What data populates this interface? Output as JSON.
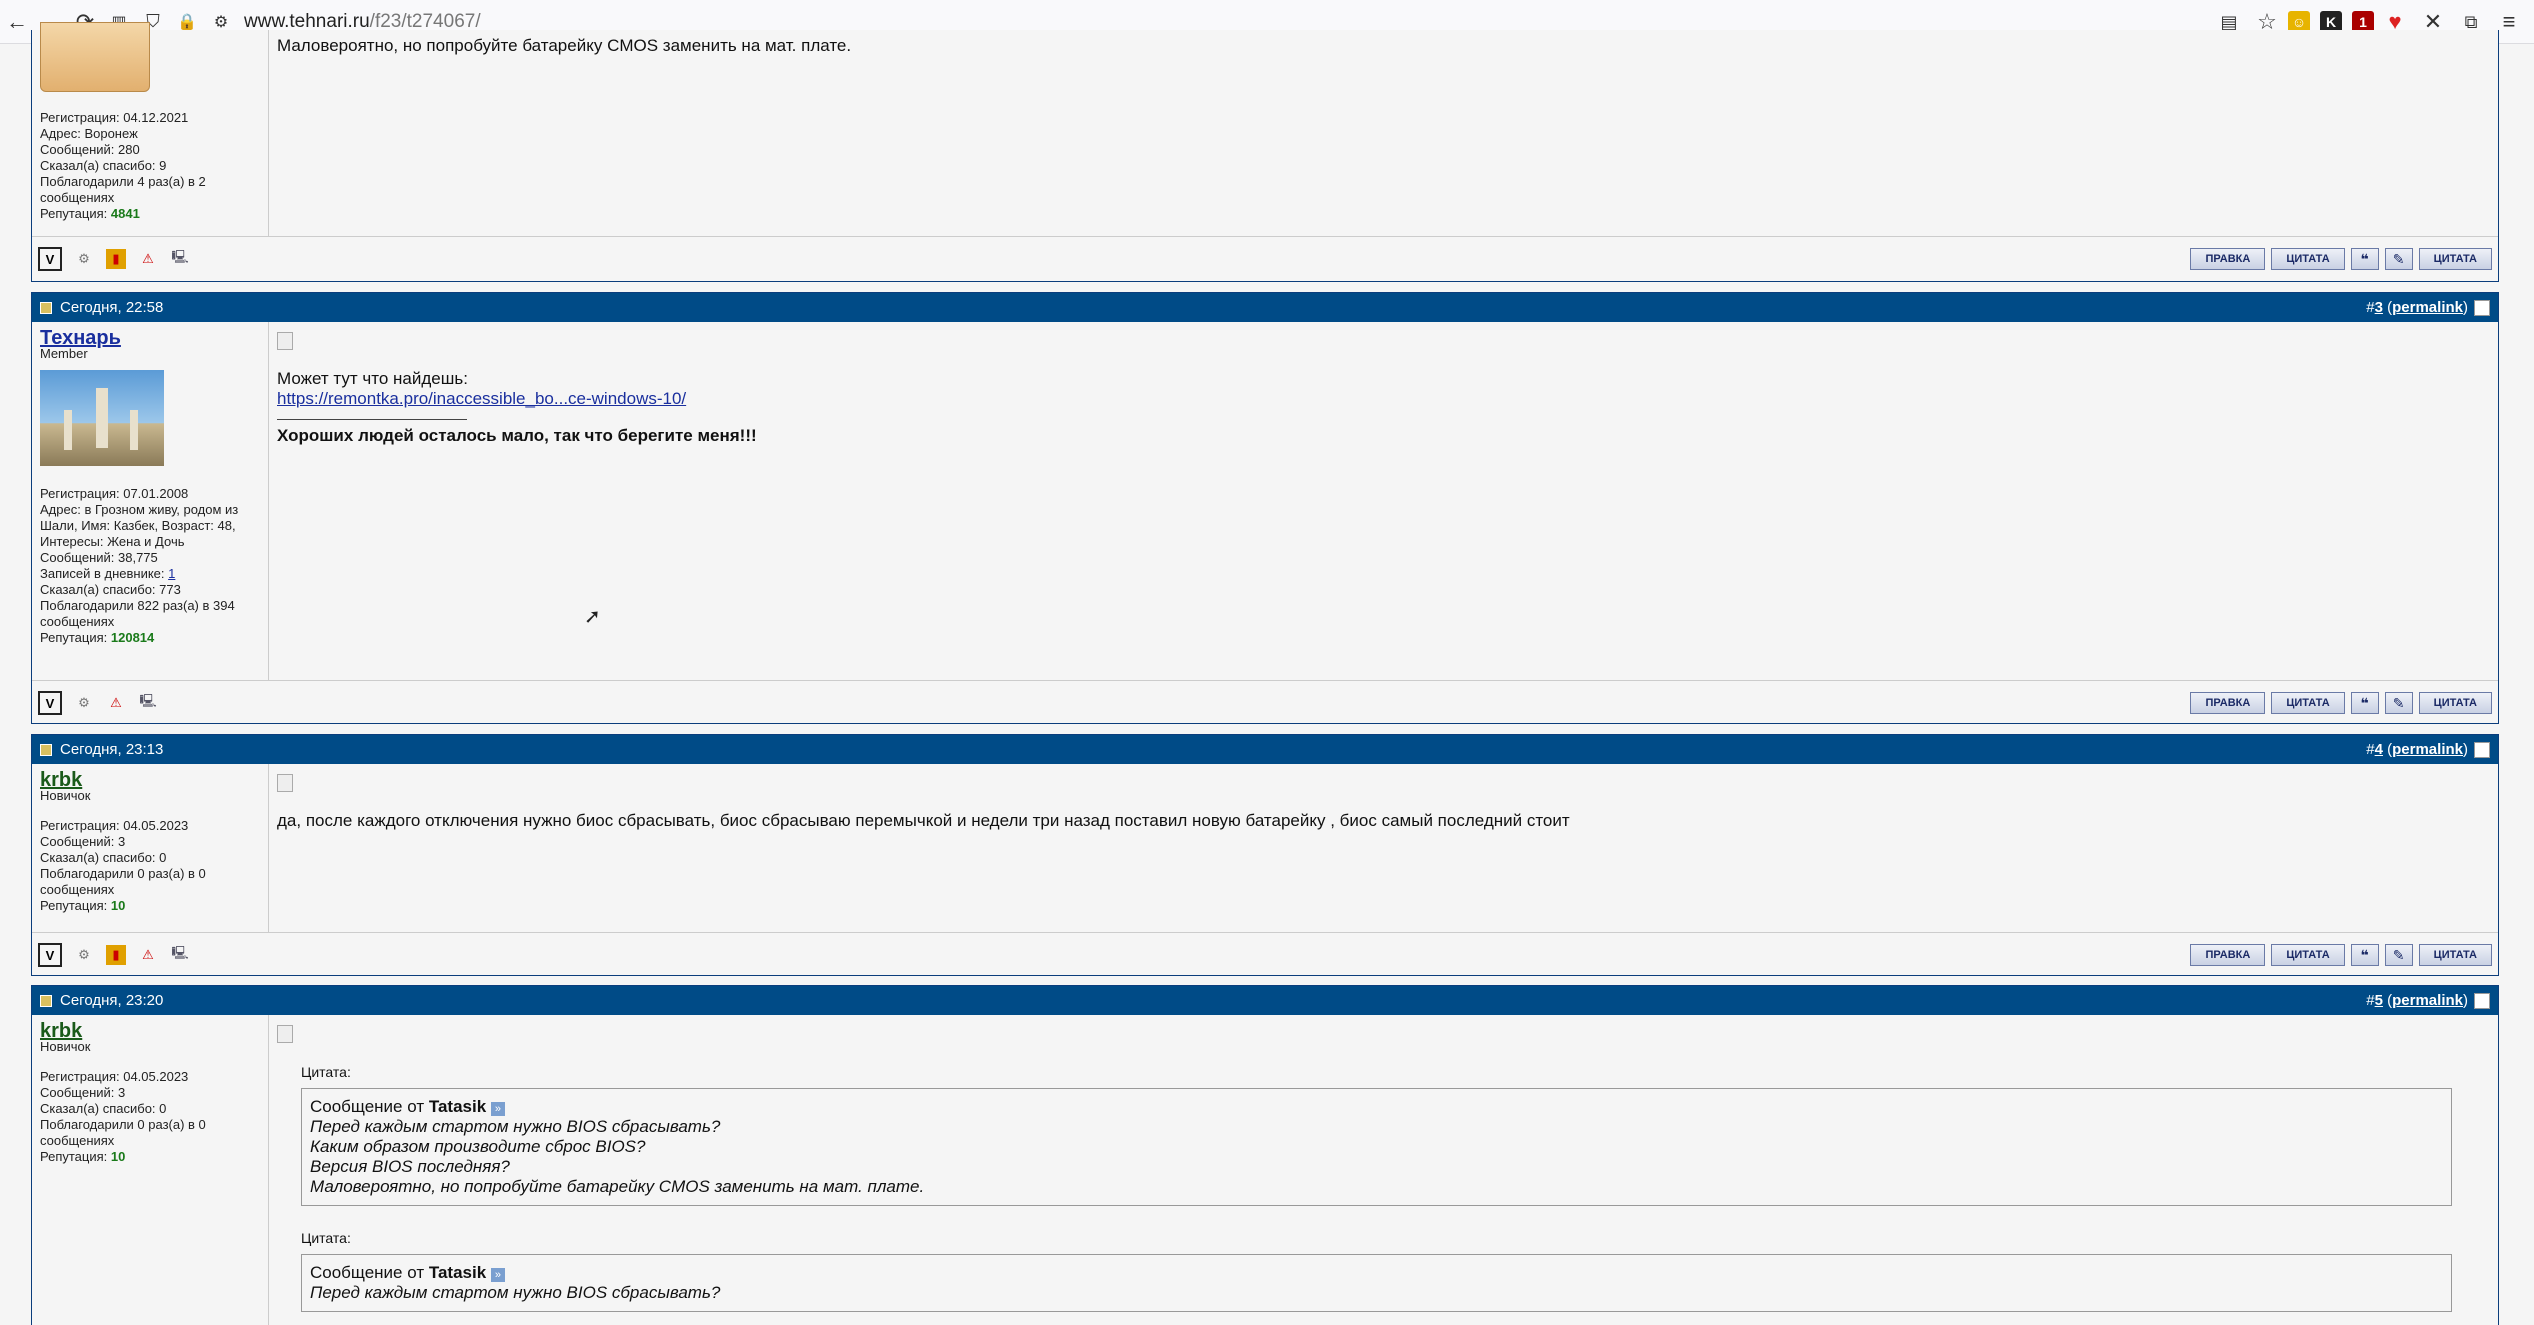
{
  "browser": {
    "url_host": "www.tehnari.ru",
    "url_path": "/f23/t274067/"
  },
  "post1": {
    "text": "Маловероятно, но попробуйте батарейку CMOS заменить на мат. плате.",
    "user_info": [
      "Регистрация: 04.12.2021",
      "Адрес: Воронеж",
      "Сообщений: 280",
      "Сказал(а) спасибо: 9",
      "Поблагодарили 4 раз(а) в 2 сообщениях"
    ],
    "rep_label": "Репутация: ",
    "rep_value": "4841"
  },
  "post3": {
    "date": "Сегодня, 22:58",
    "num_prefix": "#",
    "num": "3",
    "permalink": "permalink",
    "username": "Технарь",
    "usertitle": "Member",
    "user_info": [
      "Регистрация: 07.01.2008",
      "Адрес: в Грозном живу, родом из Шали, Имя: Казбек, Возраст: 48, Интересы: Жена и Дочь",
      "Сообщений: 38,775"
    ],
    "diary_label": "Записей в дневнике: ",
    "diary_value": "1",
    "user_info2": [
      "Сказал(а) спасибо: 773",
      "Поблагодарили 822 раз(а) в 394 сообщениях"
    ],
    "rep_label": "Репутация: ",
    "rep_value": "120814",
    "text": "Может тут что найдешь:",
    "link": "https://remontka.pro/inaccessible_bo...ce-windows-10/",
    "signature": "Хороших людей осталось мало, так что берегите меня!!!"
  },
  "post4": {
    "date": "Сегодня, 23:13",
    "num_prefix": "#",
    "num": "4",
    "permalink": "permalink",
    "username": "krbk",
    "usertitle": "Новичок",
    "user_info": [
      "Регистрация: 04.05.2023",
      "Сообщений: 3",
      "Сказал(а) спасибо: 0",
      "Поблагодарили 0 раз(а) в 0 сообщениях"
    ],
    "rep_label": "Репутация: ",
    "rep_value": "10",
    "text": "да, после каждого отключения нужно биос сбрасывать, биос сбрасываю перемычкой и недели три назад поставил новую батарейку , биос самый последний стоит"
  },
  "post5": {
    "date": "Сегодня, 23:20",
    "num_prefix": "#",
    "num": "5",
    "permalink": "permalink",
    "username": "krbk",
    "usertitle": "Новичок",
    "user_info": [
      "Регистрация: 04.05.2023",
      "Сообщений: 3",
      "Сказал(а) спасибо: 0",
      "Поблагодарили 0 раз(а) в 0 сообщениях"
    ],
    "rep_label": "Репутация: ",
    "rep_value": "10",
    "quote_label": "Цитата:",
    "quote_from": "Сообщение от ",
    "quote_author": "Tatasik",
    "quote1_lines": [
      "Перед каждым стартом нужно BIOS сбрасывать?",
      "Каким образом производите сброс BIOS?",
      "Версия BIOS последняя?",
      "Маловероятно, но попробуйте батарейку CMOS заменить на мат. плате."
    ],
    "quote2_lines": [
      "Перед каждым стартом нужно BIOS сбрасывать?"
    ]
  },
  "buttons": {
    "edit": "ПРАВКА",
    "quote": "ЦИТАТА",
    "multiquote": "ЦИТАТА"
  }
}
